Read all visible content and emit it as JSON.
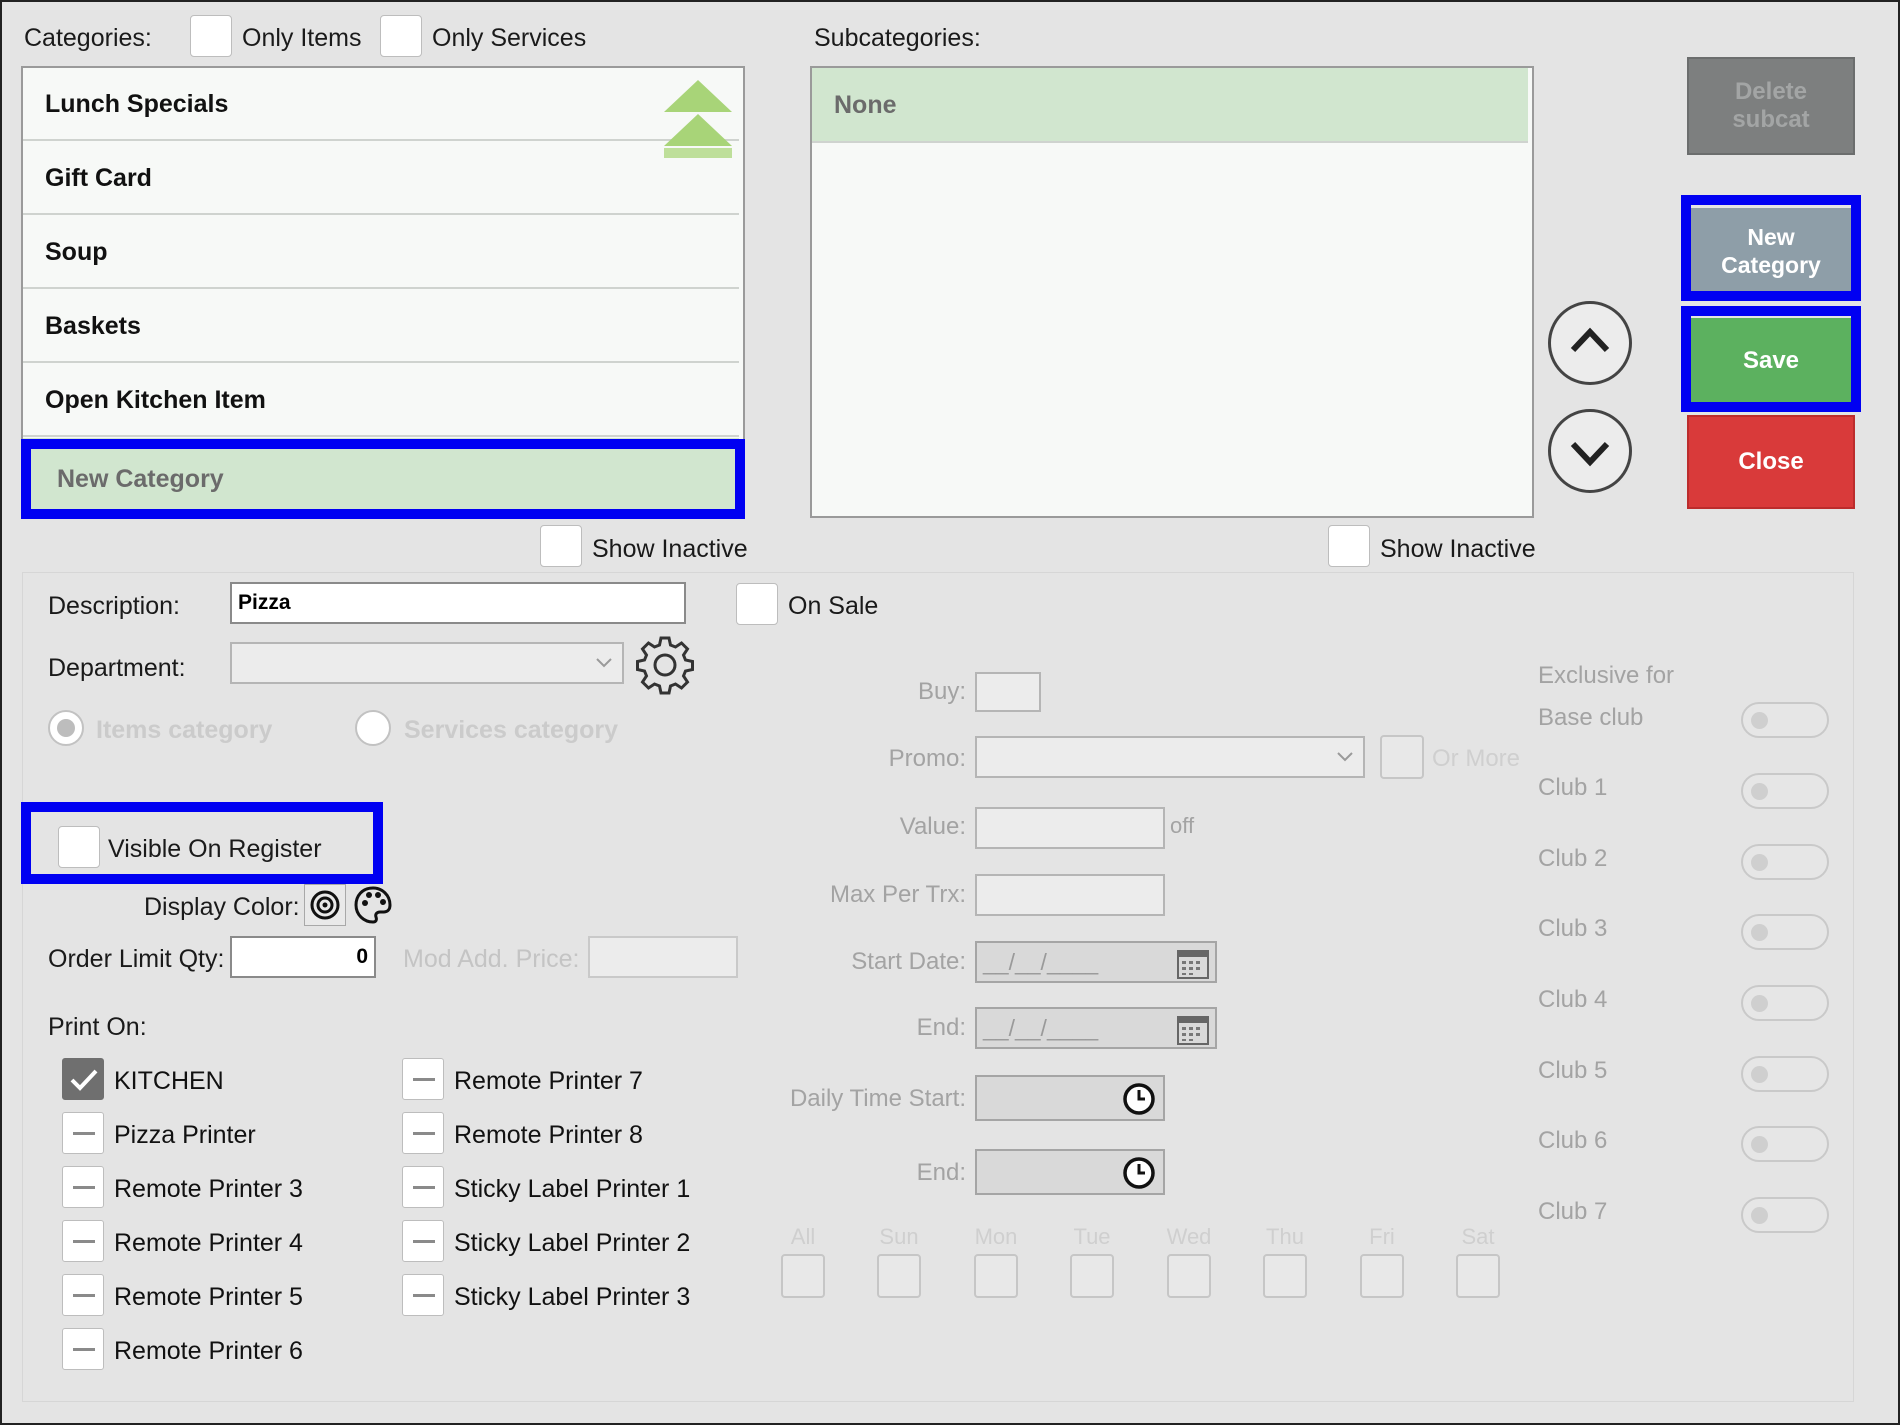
{
  "header": {
    "categories_label": "Categories:",
    "only_items_label": "Only Items",
    "only_services_label": "Only Services",
    "subcategories_label": "Subcategories:"
  },
  "categories": [
    "Lunch Specials",
    "Gift Card",
    "Soup",
    "Baskets",
    "Open Kitchen Item"
  ],
  "selected_category": "New Category",
  "subcategories": [
    "None"
  ],
  "show_inactive_label": "Show Inactive",
  "buttons": {
    "delete_subcat": "Delete subcat",
    "new_category": "New Category",
    "save": "Save",
    "close": "Close"
  },
  "form": {
    "description_label": "Description:",
    "description_value": "Pizza",
    "on_sale_label": "On Sale",
    "department_label": "Department:",
    "items_category_label": "Items category",
    "services_category_label": "Services category",
    "visible_on_register_label": "Visible On Register",
    "display_color_label": "Display Color:",
    "order_limit_label": "Order Limit Qty:",
    "order_limit_value": "0",
    "mod_add_price_label": "Mod Add. Price:",
    "print_on_label": "Print On:"
  },
  "printers": [
    {
      "name": "KITCHEN",
      "checked": true
    },
    {
      "name": "Pizza Printer",
      "checked": false
    },
    {
      "name": "Remote Printer 3",
      "checked": false
    },
    {
      "name": "Remote Printer 4",
      "checked": false
    },
    {
      "name": "Remote Printer 5",
      "checked": false
    },
    {
      "name": "Remote Printer 6",
      "checked": false
    },
    {
      "name": "Remote Printer 7",
      "checked": false
    },
    {
      "name": "Remote Printer 8",
      "checked": false
    },
    {
      "name": "Sticky Label Printer 1",
      "checked": false
    },
    {
      "name": "Sticky Label Printer 2",
      "checked": false
    },
    {
      "name": "Sticky Label Printer 3",
      "checked": false
    }
  ],
  "promo": {
    "buy_label": "Buy:",
    "promo_label": "Promo:",
    "or_more_label": "Or More",
    "value_label": "Value:",
    "off_label": "off",
    "max_per_trx_label": "Max Per Trx:",
    "start_date_label": "Start Date:",
    "date_placeholder": "__/__/____",
    "end_label": "End:",
    "daily_time_start_label": "Daily Time Start:",
    "days": [
      "All",
      "Sun",
      "Mon",
      "Tue",
      "Wed",
      "Thu",
      "Fri",
      "Sat"
    ]
  },
  "clubs": {
    "header_line1": "Exclusive for",
    "items": [
      "Base club",
      "Club 1",
      "Club 2",
      "Club 3",
      "Club 4",
      "Club 5",
      "Club 6",
      "Club 7"
    ]
  },
  "colors": {
    "highlight": "#0000f2",
    "save": "#5cb15f",
    "close": "#d93a3a",
    "new_category": "#8e9ea8",
    "delete_subcat": "#7d7f7f",
    "selected_row": "#d1e6cf",
    "arrow": "#a8d478"
  },
  "icons": [
    "scroll-up-double-arrow-icon",
    "chevron-up-icon",
    "chevron-down-icon",
    "gear-icon",
    "target-icon",
    "palette-icon",
    "calendar-icon",
    "clock-icon",
    "checkmark-icon"
  ]
}
